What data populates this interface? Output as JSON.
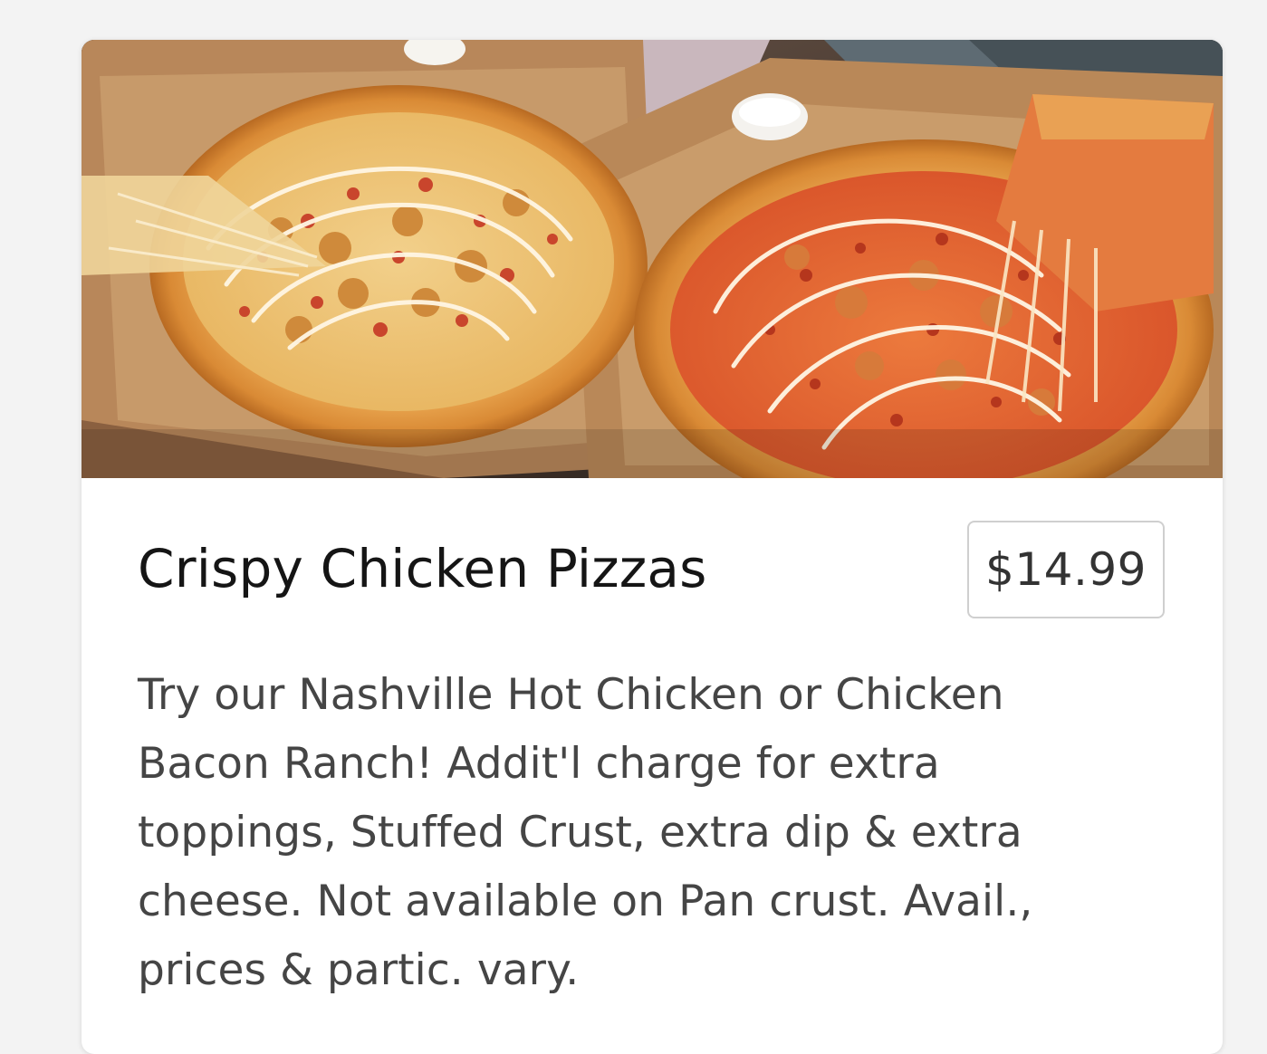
{
  "product": {
    "image_alt": "Two Crispy Chicken Pizzas in open boxes",
    "title": "Crispy Chicken Pizzas",
    "price": "$14.99",
    "description": "Try our Nashville Hot Chicken or Chicken Bacon Ranch! Addit'l charge for extra toppings, Stuffed Crust, extra dip & extra cheese. Not available on Pan crust. Avail., prices & partic. vary."
  },
  "colors": {
    "card_background": "#ffffff",
    "page_background": "#f3f3f3",
    "title_text": "#151515",
    "body_text": "#454545",
    "price_border": "#cfcfcf"
  }
}
